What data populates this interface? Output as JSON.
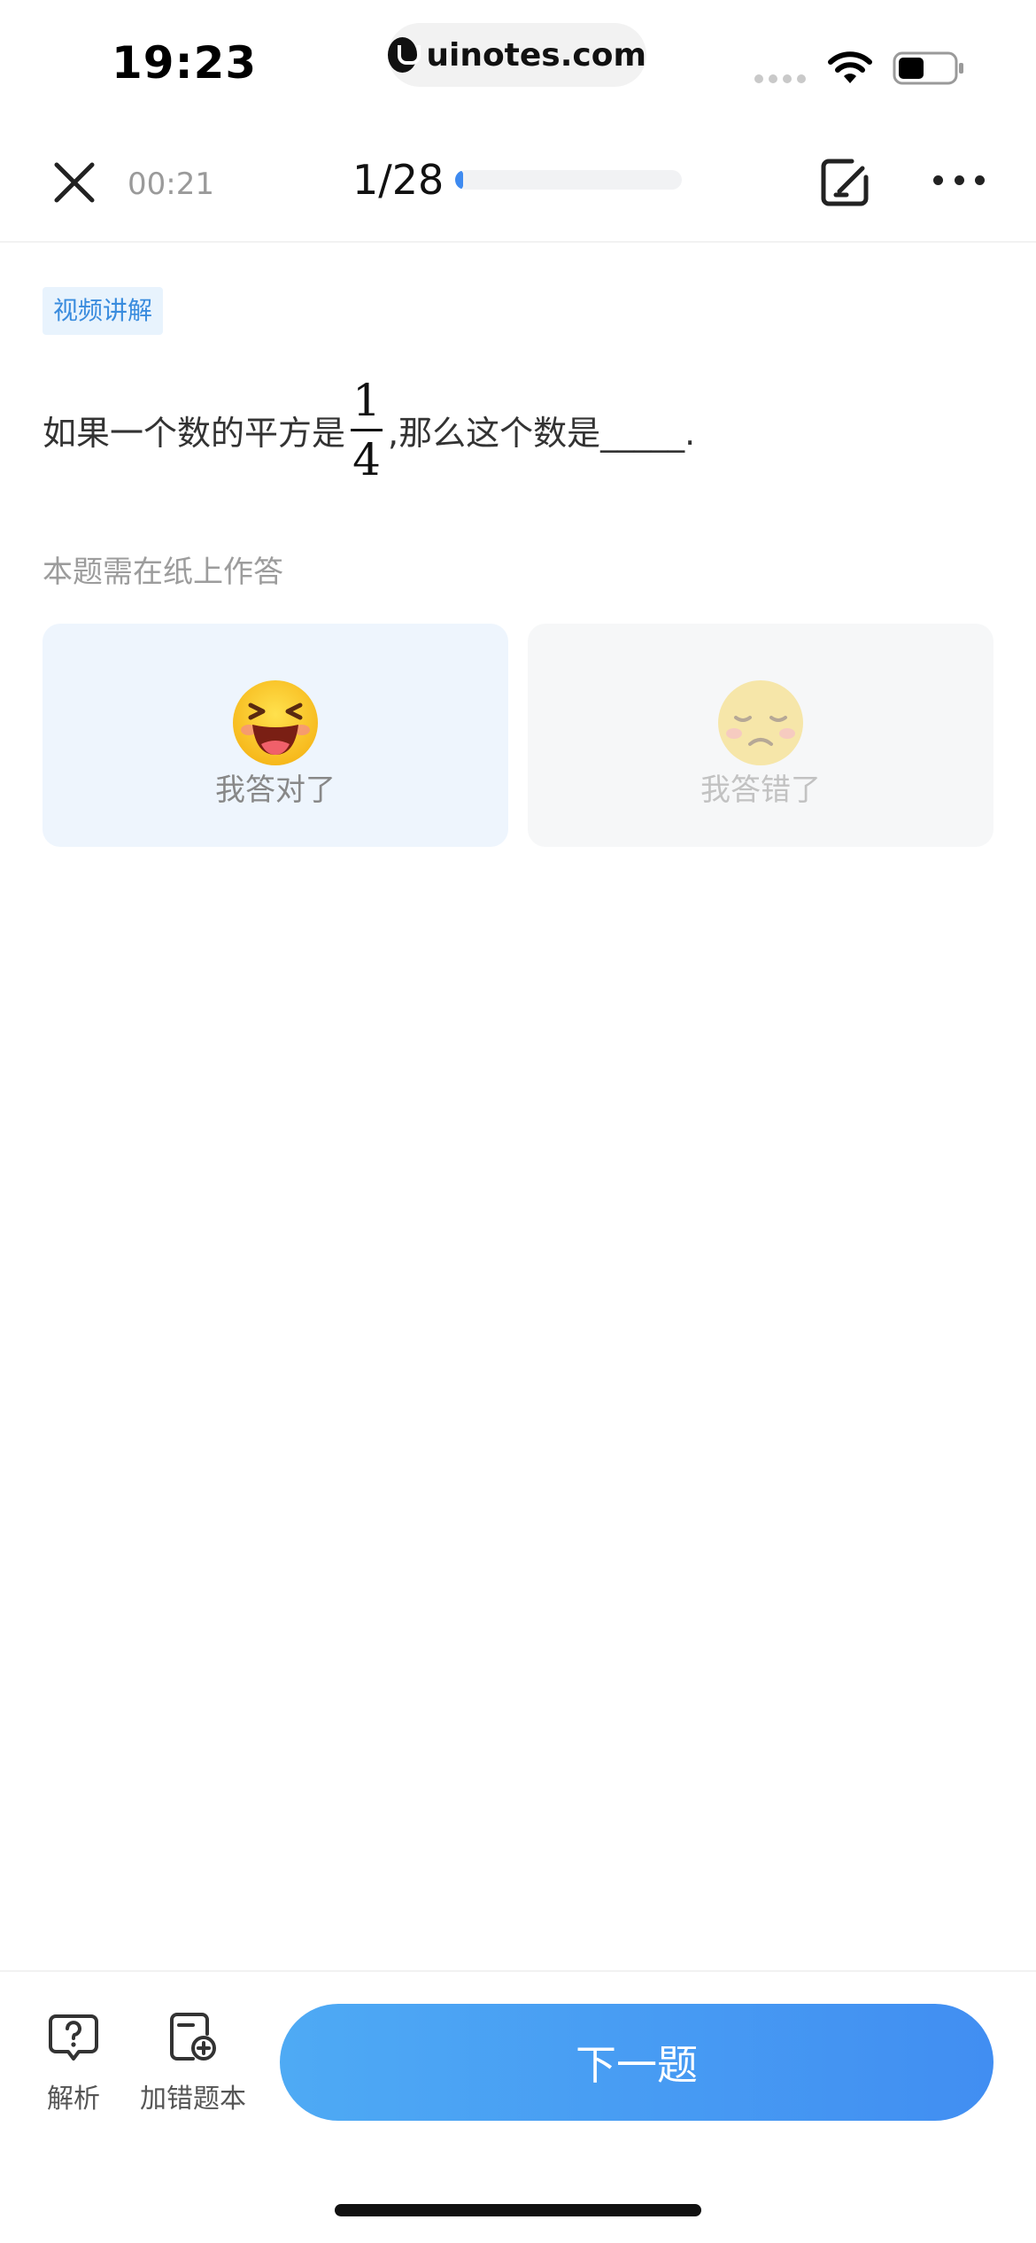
{
  "status_bar": {
    "time": "19:23",
    "url": "uinotes.com",
    "icons": [
      "signal-dots-icon",
      "wifi-icon",
      "battery-icon"
    ]
  },
  "top_nav": {
    "timer": "00:21",
    "progress_label": "1/28",
    "progress_fraction": 0.0357,
    "icons": [
      "close-icon",
      "note-edit-icon",
      "more-icon"
    ],
    "accent_color": "#3e8af0"
  },
  "question": {
    "tag": "视频讲解",
    "text_before": "如果一个数的平方是",
    "fraction_numerator": "1",
    "fraction_denominator": "4",
    "text_after": ",那么这个数是_____.",
    "paper_hint": "本题需在纸上作答"
  },
  "answers": {
    "correct_label": "我答对了",
    "wrong_label": "我答错了",
    "correct_icon": "laughing-emoji-icon",
    "wrong_icon": "sad-emoji-icon"
  },
  "bottom_bar": {
    "analysis_label": "解析",
    "add_mistake_label": "加错题本",
    "next_label": "下一题",
    "icons": [
      "question-bubble-icon",
      "add-mistake-book-icon"
    ]
  }
}
